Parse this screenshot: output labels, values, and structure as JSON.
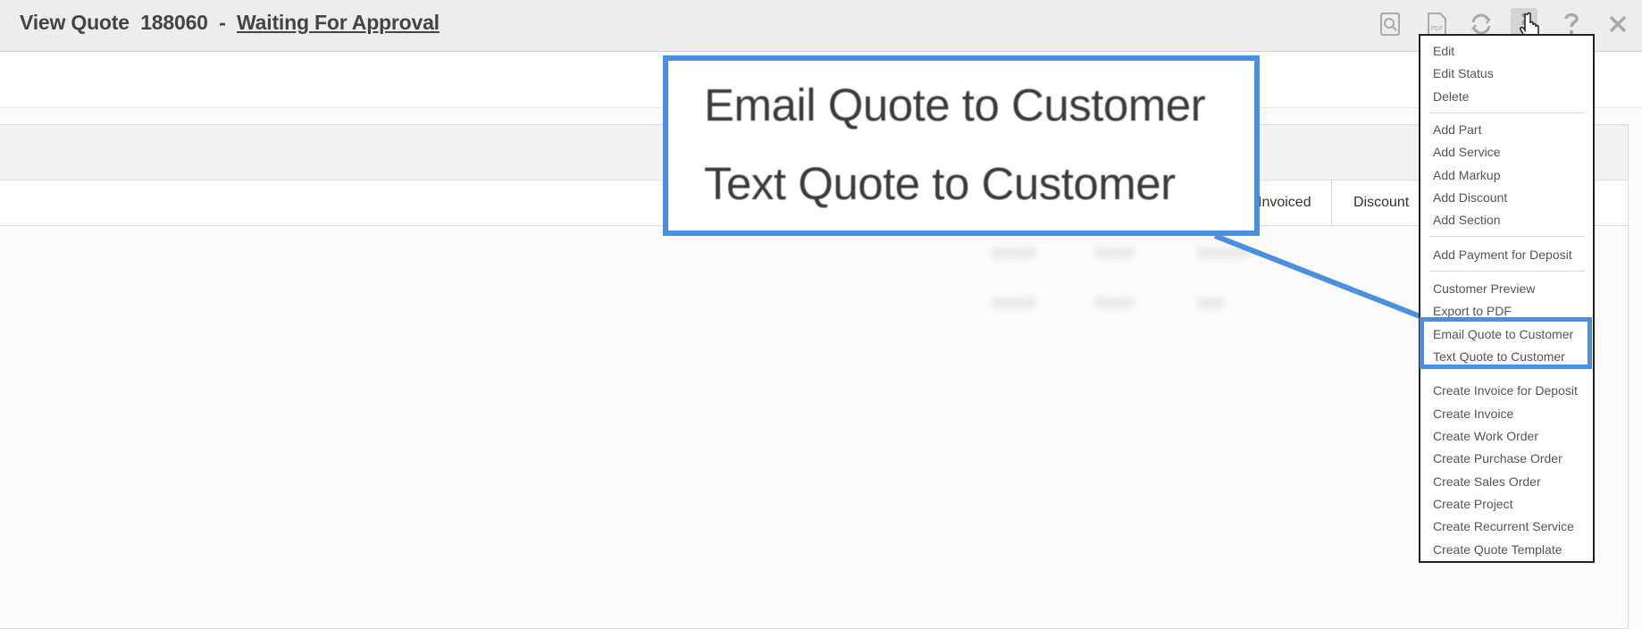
{
  "header": {
    "title_prefix": "View Quote",
    "quote_number": "188060",
    "separator": "-",
    "status": "Waiting For Approval"
  },
  "toolbar": {
    "icons": [
      "preview-icon",
      "pdf-icon",
      "refresh-icon",
      "more-vert-icon",
      "help-icon",
      "close-icon"
    ]
  },
  "table": {
    "columns": [
      "Invoiced",
      "Discount"
    ]
  },
  "callout": {
    "line1": "Email Quote to Customer",
    "line2": "Text Quote to Customer"
  },
  "menu": {
    "items": [
      "Edit",
      "Edit Status",
      "Delete",
      "Add Part",
      "Add Service",
      "Add Markup",
      "Add Discount",
      "Add Section",
      "Add Payment for Deposit",
      "Customer Preview",
      "Export to PDF",
      "Email Quote to Customer",
      "Text Quote to Customer",
      "Create Invoice for Deposit",
      "Create Invoice",
      "Create Work Order",
      "Create Purchase Order",
      "Create Sales Order",
      "Create Project",
      "Create Recurrent Service",
      "Create Quote Template"
    ]
  },
  "colors": {
    "accent": "#4a90e2",
    "header_bg": "#ededed"
  }
}
